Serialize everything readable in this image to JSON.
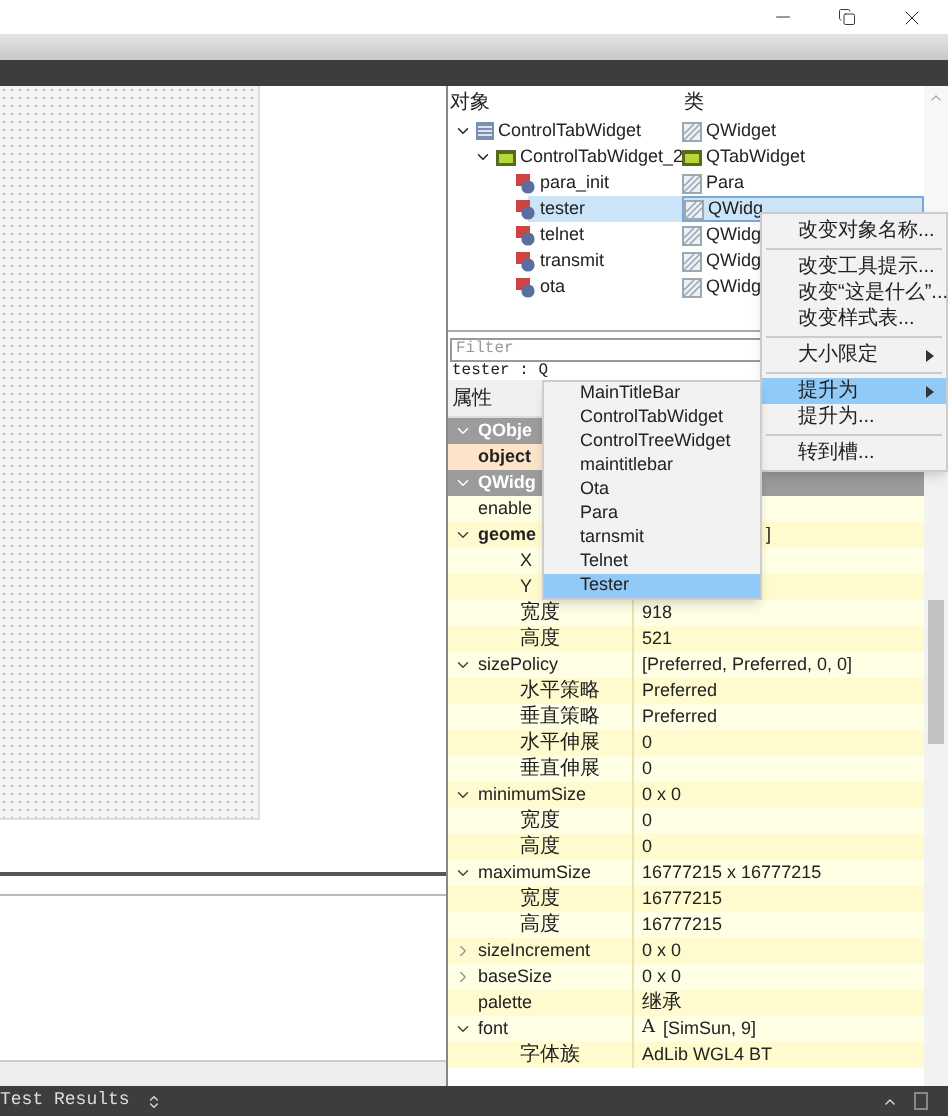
{
  "object_inspector": {
    "columns": [
      "对象",
      "类"
    ],
    "tree": [
      {
        "name": "ControlTabWidget",
        "class": "QWidget",
        "kind": "container",
        "expanded": true,
        "selected": false,
        "children": [
          {
            "name": "ControlTabWidget_2",
            "class": "QTabWidget",
            "kind": "tabs",
            "expanded": true,
            "selected": false,
            "children": [
              {
                "name": "para_init",
                "class": "Para",
                "kind": "widget",
                "selected": false
              },
              {
                "name": "tester",
                "class": "QWidg",
                "kind": "widget",
                "selected": true
              },
              {
                "name": "telnet",
                "class": "QWidg",
                "kind": "widget",
                "selected": false
              },
              {
                "name": "transmit",
                "class": "QWidg",
                "kind": "widget",
                "selected": false
              },
              {
                "name": "ota",
                "class": "QWidg",
                "kind": "widget",
                "selected": false
              }
            ]
          }
        ]
      }
    ]
  },
  "filter": {
    "placeholder": "Filter"
  },
  "current_object": "tester : Q",
  "property_editor": {
    "header": "属性",
    "rows": [
      {
        "kind": "group",
        "name": "QObje",
        "expanded": true
      },
      {
        "kind": "property",
        "name": "object",
        "value": "",
        "bold": true,
        "changed": true
      },
      {
        "kind": "group",
        "name": "QWidg",
        "expanded": true
      },
      {
        "kind": "property",
        "name": "enable",
        "value": ""
      },
      {
        "kind": "parent",
        "name": "geome",
        "value": "]",
        "bold": true,
        "expanded": true,
        "covered": true
      },
      {
        "kind": "child",
        "name": "X",
        "value": ""
      },
      {
        "kind": "child",
        "name": "Y",
        "value": ""
      },
      {
        "kind": "child",
        "name": "宽度",
        "value": "918"
      },
      {
        "kind": "child",
        "name": "高度",
        "value": "521"
      },
      {
        "kind": "parent",
        "name": "sizePolicy",
        "value": "[Preferred, Preferred, 0, 0]",
        "expanded": true
      },
      {
        "kind": "child",
        "name": "水平策略",
        "value": "Preferred"
      },
      {
        "kind": "child",
        "name": "垂直策略",
        "value": "Preferred"
      },
      {
        "kind": "child",
        "name": "水平伸展",
        "value": "0"
      },
      {
        "kind": "child",
        "name": "垂直伸展",
        "value": "0"
      },
      {
        "kind": "parent",
        "name": "minimumSize",
        "value": "0 x 0",
        "expanded": true
      },
      {
        "kind": "child",
        "name": "宽度",
        "value": "0"
      },
      {
        "kind": "child",
        "name": "高度",
        "value": "0"
      },
      {
        "kind": "parent",
        "name": "maximumSize",
        "value": "16777215 x 16777215",
        "expanded": true
      },
      {
        "kind": "child",
        "name": "宽度",
        "value": "16777215"
      },
      {
        "kind": "child",
        "name": "高度",
        "value": "16777215"
      },
      {
        "kind": "parent",
        "name": "sizeIncrement",
        "value": "0 x 0",
        "expanded": false
      },
      {
        "kind": "parent",
        "name": "baseSize",
        "value": "0 x 0",
        "expanded": false
      },
      {
        "kind": "property",
        "name": "palette",
        "value": "继承"
      },
      {
        "kind": "parent",
        "name": "font",
        "value": "[SimSun, 9]",
        "expanded": true,
        "value_icon": "A"
      },
      {
        "kind": "child",
        "name": "字体族",
        "value": "AdLib WGL4 BT"
      }
    ]
  },
  "context_menu": {
    "items": [
      {
        "kind": "item",
        "label": "改变对象名称...",
        "selected": false
      },
      {
        "kind": "separator"
      },
      {
        "kind": "item",
        "label": "改变工具提示...",
        "selected": false
      },
      {
        "kind": "item",
        "label": "改变“这是什么”...",
        "selected": false
      },
      {
        "kind": "item",
        "label": "改变样式表...",
        "selected": false
      },
      {
        "kind": "separator"
      },
      {
        "kind": "item",
        "label": "大小限定",
        "submenu": true,
        "selected": false
      },
      {
        "kind": "separator"
      },
      {
        "kind": "item",
        "label": "提升为",
        "submenu": true,
        "selected": true
      },
      {
        "kind": "item",
        "label": "提升为...",
        "selected": false
      },
      {
        "kind": "separator"
      },
      {
        "kind": "item",
        "label": "转到槽...",
        "selected": false
      }
    ]
  },
  "promote_submenu": {
    "items": [
      {
        "label": "MainTitleBar",
        "selected": false
      },
      {
        "label": "ControlTabWidget",
        "selected": false
      },
      {
        "label": "ControlTreeWidget",
        "selected": false
      },
      {
        "label": "maintitlebar",
        "selected": false
      },
      {
        "label": "Ota",
        "selected": false
      },
      {
        "label": "Para",
        "selected": false
      },
      {
        "label": "tarnsmit",
        "selected": false
      },
      {
        "label": "Telnet",
        "selected": false
      },
      {
        "label": "Tester",
        "selected": true
      }
    ]
  },
  "bottom_bar": {
    "label": "Test Results"
  }
}
